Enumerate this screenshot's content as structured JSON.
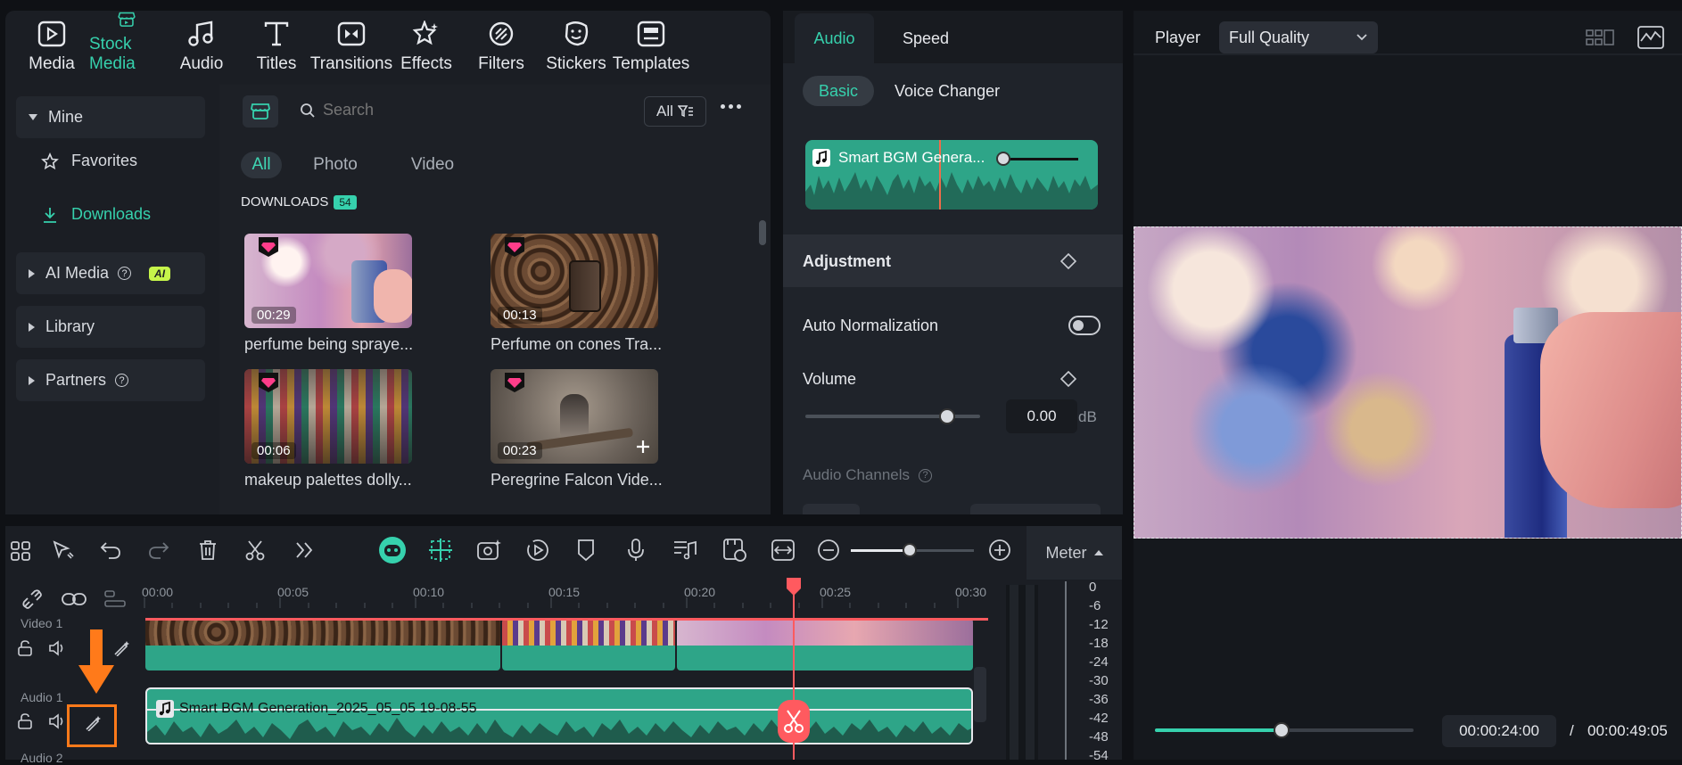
{
  "toolbar": {
    "items": [
      {
        "label": "Media",
        "icon": "media-icon"
      },
      {
        "label": "Stock Media",
        "icon": "stock-media-icon",
        "active": true
      },
      {
        "label": "Audio",
        "icon": "audio-icon"
      },
      {
        "label": "Titles",
        "icon": "titles-icon"
      },
      {
        "label": "Transitions",
        "icon": "transitions-icon"
      },
      {
        "label": "Effects",
        "icon": "effects-icon"
      },
      {
        "label": "Filters",
        "icon": "filters-icon"
      },
      {
        "label": "Stickers",
        "icon": "stickers-icon"
      },
      {
        "label": "Templates",
        "icon": "templates-icon"
      }
    ]
  },
  "sidebar": {
    "mine": "Mine",
    "favorites": "Favorites",
    "downloads": "Downloads",
    "ai_media": "AI Media",
    "ai_badge": "AI",
    "library": "Library",
    "partners": "Partners"
  },
  "stock": {
    "search_placeholder": "Search",
    "filter_label": "All",
    "tabs": [
      "All",
      "Photo",
      "Video"
    ],
    "section_title": "DOWNLOADS",
    "section_count": "54",
    "items": [
      {
        "duration": "00:29",
        "caption": "perfume being spraye..."
      },
      {
        "duration": "00:13",
        "caption": "Perfume on cones Tra..."
      },
      {
        "duration": "00:06",
        "caption": "makeup palettes dolly..."
      },
      {
        "duration": "00:23",
        "caption": "Peregrine Falcon Vide..."
      }
    ]
  },
  "audio_panel": {
    "tabs": [
      "Audio",
      "Speed"
    ],
    "subtabs": [
      "Basic",
      "Voice Changer"
    ],
    "clip_name": "Smart BGM Genera...",
    "adjustment": "Adjustment",
    "auto_normalization": "Auto Normalization",
    "volume": "Volume",
    "volume_value": "0.00",
    "volume_unit": "dB",
    "audio_channels": "Audio Channels",
    "volume_level": 0.81
  },
  "player": {
    "label": "Player",
    "quality": "Full Quality",
    "current_time": "00:00:24:00",
    "separator": "/",
    "total_time": "00:00:49:05",
    "progress": 0.49
  },
  "timeline": {
    "meter_label": "Meter",
    "ruler": [
      "00:00",
      "00:05",
      "00:10",
      "00:15",
      "00:20",
      "00:25",
      "00:30"
    ],
    "tracks": {
      "video": "Video 1",
      "audio": "Audio 1",
      "audio2": "Audio 2"
    },
    "audio_clip_name": "Smart BGM Generation_2025_05_05 19-08-55",
    "meter_scale": [
      "0",
      "-6",
      "-12",
      "-18",
      "-24",
      "-30",
      "-36",
      "-42",
      "-48",
      "-54"
    ]
  },
  "colors": {
    "accent": "#36d1ad",
    "playhead": "#ff5a5f",
    "highlight": "#ff7a1a",
    "clip": "#2ea588"
  }
}
